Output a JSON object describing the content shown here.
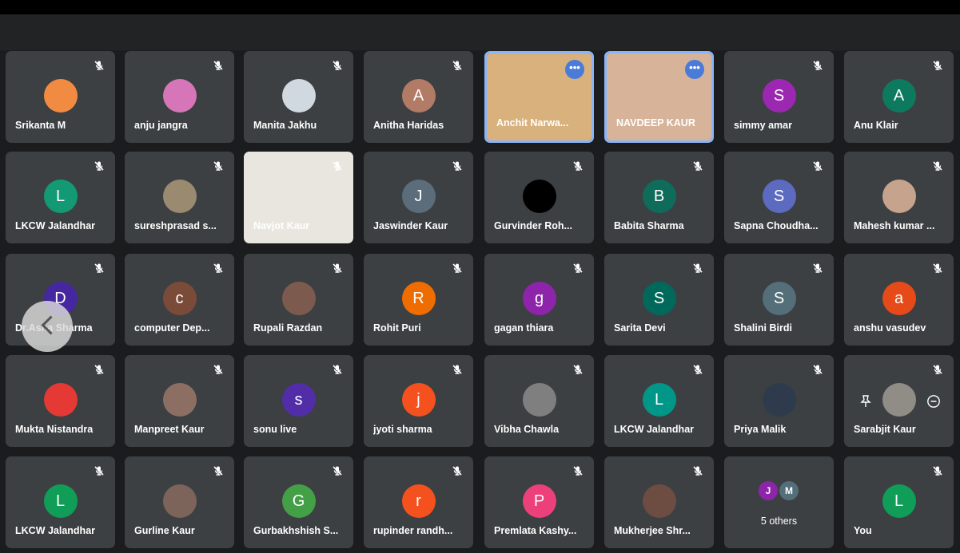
{
  "meeting": {
    "participants": [
      {
        "name": "Srikanta M",
        "initial": "",
        "color": "#f28b42",
        "photo": true
      },
      {
        "name": "anju jangra",
        "initial": "",
        "color": "#d676b8",
        "photo": true
      },
      {
        "name": "Manita Jakhu",
        "initial": "",
        "color": "#cfd9df",
        "photo": true
      },
      {
        "name": "Anitha Haridas",
        "initial": "A",
        "color": "#b27b66"
      },
      {
        "name": "Anchit Narwa...",
        "video": true,
        "speaking": true,
        "video_bg": "#d8b17d"
      },
      {
        "name": "NAVDEEP KAUR",
        "video": true,
        "speaking": true,
        "video_bg": "#d7b39a"
      },
      {
        "name": "simmy amar",
        "initial": "S",
        "color": "#9c27b0"
      },
      {
        "name": "Anu Klair",
        "initial": "A",
        "color": "#0d7a5f"
      },
      {
        "name": "LKCW Jalandhar",
        "initial": "L",
        "color": "#139a74"
      },
      {
        "name": "sureshprasad s...",
        "initial": "",
        "color": "#9a8a70",
        "photo": true
      },
      {
        "name": "Navjot Kaur",
        "video": true,
        "speaking": false,
        "video_bg": "#e9e6df"
      },
      {
        "name": "Jaswinder Kaur",
        "initial": "J",
        "color": "#5b6d7a"
      },
      {
        "name": "Gurvinder Roh...",
        "initial": "",
        "color": "#000000",
        "photo": true
      },
      {
        "name": "Babita Sharma",
        "initial": "B",
        "color": "#0f6b5a"
      },
      {
        "name": "Sapna Choudha...",
        "initial": "S",
        "color": "#5c6bc0"
      },
      {
        "name": "Mahesh kumar ...",
        "initial": "",
        "color": "#c5a38d",
        "photo": true
      },
      {
        "name": "Dr.Asha Sharma",
        "initial": "D",
        "color": "#4527a0"
      },
      {
        "name": "computer Dep...",
        "initial": "c",
        "color": "#7b4b3a"
      },
      {
        "name": "Rupali Razdan",
        "initial": "",
        "color": "#7c5b4e",
        "photo": true
      },
      {
        "name": "Rohit Puri",
        "initial": "R",
        "color": "#ef6c00"
      },
      {
        "name": "gagan thiara",
        "initial": "g",
        "color": "#8e24aa"
      },
      {
        "name": "Sarita Devi",
        "initial": "S",
        "color": "#00695c"
      },
      {
        "name": "Shalini Birdi",
        "initial": "S",
        "color": "#546e7a"
      },
      {
        "name": "anshu vasudev",
        "initial": "a",
        "color": "#e64a19"
      },
      {
        "name": "Mukta Nistandra",
        "initial": "",
        "color": "#e53935",
        "photo": true
      },
      {
        "name": "Manpreet Kaur",
        "initial": "",
        "color": "#8d6e63",
        "photo": true
      },
      {
        "name": "sonu live",
        "initial": "s",
        "color": "#512da8"
      },
      {
        "name": "jyoti sharma",
        "initial": "j",
        "color": "#f4511e"
      },
      {
        "name": "Vibha Chawla",
        "initial": "",
        "color": "#7f7f7f",
        "photo": true
      },
      {
        "name": "LKCW Jalandhar",
        "initial": "L",
        "color": "#009688"
      },
      {
        "name": "Priya Malik",
        "initial": "",
        "color": "#2d3b4d",
        "photo": true
      },
      {
        "name": "Sarabjit Kaur",
        "initial": "",
        "color": "#908c86",
        "photo": true,
        "hover_controls": true
      },
      {
        "name": "LKCW Jalandhar",
        "initial": "L",
        "color": "#0f9d58"
      },
      {
        "name": "Gurline Kaur",
        "initial": "",
        "color": "#7c645a",
        "photo": true
      },
      {
        "name": "Gurbakhshish S...",
        "initial": "G",
        "color": "#43a047"
      },
      {
        "name": "rupinder randh...",
        "initial": "r",
        "color": "#f4511e"
      },
      {
        "name": "Premlata Kashy...",
        "initial": "P",
        "color": "#ec407a"
      },
      {
        "name": "Mukherjee Shr...",
        "initial": "",
        "color": "#6d4c41",
        "photo": true
      },
      {
        "others": true,
        "label": "5 others",
        "minis": [
          {
            "initial": "J",
            "color": "#8e24aa"
          },
          {
            "initial": "M",
            "color": "#546e7a"
          }
        ]
      },
      {
        "name": "You",
        "initial": "L",
        "color": "#0f9d58"
      }
    ]
  },
  "icons": {
    "muted": "mic-off-icon",
    "more": "more-horizontal-icon",
    "pin": "pin-icon",
    "remove": "minus-circle-icon",
    "prev": "chevron-left-icon"
  },
  "badges": {
    "more_dots": "•••"
  }
}
